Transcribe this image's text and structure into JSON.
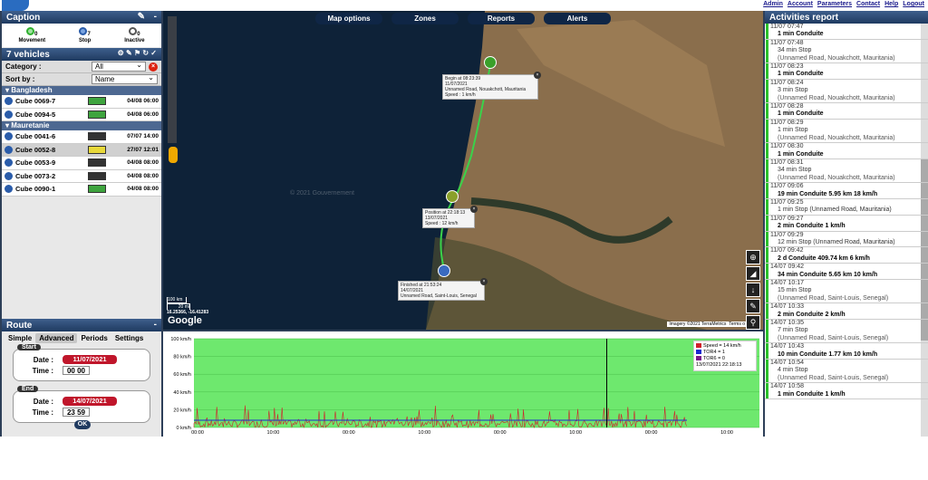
{
  "topnav": {
    "links": [
      "Admin",
      "Account",
      "Parameters",
      "Contact",
      "Help",
      "Logout"
    ]
  },
  "caption": {
    "title": "Caption",
    "items": [
      {
        "count": "0",
        "label": "Movement",
        "color": "#2fb02f"
      },
      {
        "count": "7",
        "label": "Stop",
        "color": "#2a5caa"
      },
      {
        "count": "0",
        "label": "Inactive",
        "color": "#ffffff"
      }
    ]
  },
  "vehicles": {
    "title": "7 vehicles",
    "category_label": "Category :",
    "category_value": "All",
    "sort_label": "Sort by :",
    "sort_value": "Name",
    "groups": [
      {
        "name": "Bangladesh",
        "items": [
          {
            "name": "Cube 0069-7",
            "date": "04/08 06:00",
            "battery": "green"
          },
          {
            "name": "Cube 0094-5",
            "date": "04/08 06:00",
            "battery": "green"
          }
        ]
      },
      {
        "name": "Mauretanie",
        "items": [
          {
            "name": "Cube 0041-6",
            "date": "07/07 14:00",
            "battery": "dark"
          },
          {
            "name": "Cube 0052-8",
            "date": "27/07 12:01",
            "battery": "yellow",
            "selected": true
          },
          {
            "name": "Cube 0053-9",
            "date": "04/08 08:00",
            "battery": "dark"
          },
          {
            "name": "Cube 0073-2",
            "date": "04/08 08:00",
            "battery": "dark"
          },
          {
            "name": "Cube 0090-1",
            "date": "04/08 08:00",
            "battery": "green"
          }
        ]
      }
    ]
  },
  "route": {
    "title": "Route",
    "tabs": [
      "Simple",
      "Advanced",
      "Periods",
      "Settings"
    ],
    "start_label": "Start",
    "end_label": "End",
    "date_label": "Date :",
    "time_label": "Time :",
    "start_date": "11/07/2021",
    "start_h": "00",
    "start_m": "00",
    "end_date": "14/07/2021",
    "end_h": "23",
    "end_m": "59",
    "ok": "OK"
  },
  "map": {
    "buttons": [
      "Map options",
      "Zones",
      "Reports",
      "Alerts"
    ],
    "popups": [
      {
        "lines": [
          "Begin at 08:23:39",
          "11/07/2021",
          "Unnamed Road, Nouakchott, Mauritania",
          "Speed : 1 km/h"
        ]
      },
      {
        "lines": [
          "Position at 22:18:13",
          "13/07/2021",
          "Speed : 12 km/h"
        ]
      },
      {
        "lines": [
          "Finished at 21:53:24",
          "14/07/2021",
          "Unnamed Road, Saint-Louis, Senegal"
        ]
      }
    ],
    "scale": [
      "100 km",
      "20 mi"
    ],
    "coords": "16.25366, -16.41283",
    "google": "Google",
    "imagery": "Imagery ©2021 TerraMetrics",
    "terms": "Terms o",
    "watermark": "© 2021 Gouvernement"
  },
  "chart_data": {
    "type": "line",
    "y_ticks": [
      "100 km/h",
      "80 km/h",
      "60 km/h",
      "40 km/h",
      "20 km/h",
      "0 km/h"
    ],
    "x_ticks": [
      "00:00",
      "10:00",
      "00:00",
      "10:00",
      "00:00",
      "10:00",
      "00:00",
      "10:00"
    ],
    "ylim": [
      0,
      100
    ],
    "legend": [
      {
        "name": "Speed = 14 km/h",
        "color": "#d0202a"
      },
      {
        "name": "TOR4 = 1",
        "color": "#1a2ad0"
      },
      {
        "name": "TOR6 = 0",
        "color": "#7a1a8a"
      }
    ],
    "cursor_time": "13/07/2021 22:18:13"
  },
  "activities": {
    "title": "Activities report",
    "items": [
      {
        "time": "11/07 07:47",
        "desc": "1 min Conduite",
        "type": "drive"
      },
      {
        "time": "11/07 07:48",
        "desc": "34 min Stop",
        "addr": "(Unnamed Road, Nouakchott, Mauritania)",
        "type": "stop"
      },
      {
        "time": "11/07 08:23",
        "desc": "1 min Conduite",
        "type": "drive"
      },
      {
        "time": "11/07 08:24",
        "desc": "3 min Stop",
        "addr": "(Unnamed Road, Nouakchott, Mauritania)",
        "type": "stop"
      },
      {
        "time": "11/07 08:28",
        "desc": "1 min Conduite",
        "type": "drive"
      },
      {
        "time": "11/07 08:29",
        "desc": "1 min Stop",
        "addr": "(Unnamed Road, Nouakchott, Mauritania)",
        "type": "stop"
      },
      {
        "time": "11/07 08:30",
        "desc": "1 min Conduite",
        "type": "drive"
      },
      {
        "time": "11/07 08:31",
        "desc": "34 min Stop",
        "addr": "(Unnamed Road, Nouakchott, Mauritania)",
        "type": "stop"
      },
      {
        "time": "11/07 09:06",
        "desc": "19 min Conduite 5.95 km 18 km/h",
        "type": "drive"
      },
      {
        "time": "11/07 09:25",
        "desc": "1 min Stop (Unnamed Road, Mauritania)",
        "type": "stop"
      },
      {
        "time": "11/07 09:27",
        "desc": "2 min Conduite 1 km/h",
        "type": "drive"
      },
      {
        "time": "11/07 09:29",
        "desc": "12 min Stop (Unnamed Road, Mauritania)",
        "type": "stop"
      },
      {
        "time": "11/07 09:42",
        "desc": "2 d Conduite 409.74 km 6 km/h",
        "type": "drive"
      },
      {
        "time": "14/07 09:42",
        "desc": "34 min Conduite 5.65 km 10 km/h",
        "type": "drive"
      },
      {
        "time": "14/07 10:17",
        "desc": "15 min Stop",
        "addr": "(Unnamed Road, Saint-Louis, Senegal)",
        "type": "stop"
      },
      {
        "time": "14/07 10:33",
        "desc": "2 min Conduite 2 km/h",
        "type": "drive"
      },
      {
        "time": "14/07 10:35",
        "desc": "7 min Stop",
        "addr": "(Unnamed Road, Saint-Louis, Senegal)",
        "type": "stop"
      },
      {
        "time": "14/07 10:43",
        "desc": "10 min Conduite 1.77 km 10 km/h",
        "type": "drive"
      },
      {
        "time": "14/07 10:54",
        "desc": "4 min Stop",
        "addr": "(Unnamed Road, Saint-Louis, Senegal)",
        "type": "stop"
      },
      {
        "time": "14/07 10:58",
        "desc": "1 min Conduite 1 km/h",
        "type": "drive"
      }
    ]
  }
}
